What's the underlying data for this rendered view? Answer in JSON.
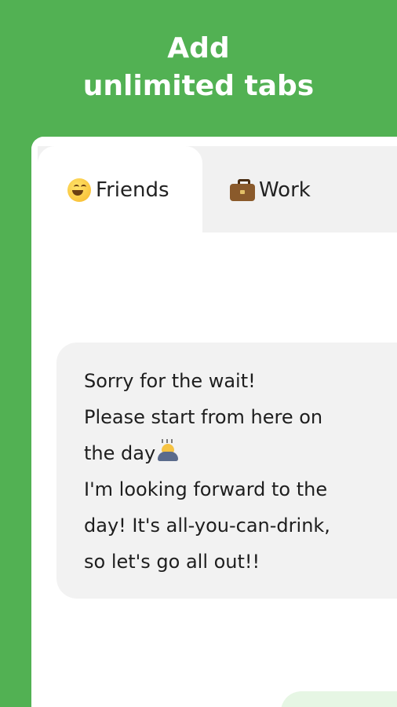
{
  "headline": {
    "line1": "Add",
    "line2": "unlimited tabs"
  },
  "tabs": [
    {
      "label": "Friends",
      "icon": "grinning-face-icon",
      "active": true
    },
    {
      "label": "Work",
      "icon": "briefcase-icon",
      "active": false
    }
  ],
  "add_tab_icon": "plus-icon",
  "message": {
    "lines": [
      "Sorry for the wait!",
      "Please start from here on",
      "the day",
      "I'm looking forward to the",
      "day! It's all-you-can-drink,",
      "so let's go all out!!"
    ],
    "inline_icon": "bowing-person-icon"
  },
  "colors": {
    "background": "#52b153",
    "tab_inactive": "#f1f1f1",
    "bubble": "#f2f2f2",
    "reply_bubble": "#e6f6e4"
  }
}
